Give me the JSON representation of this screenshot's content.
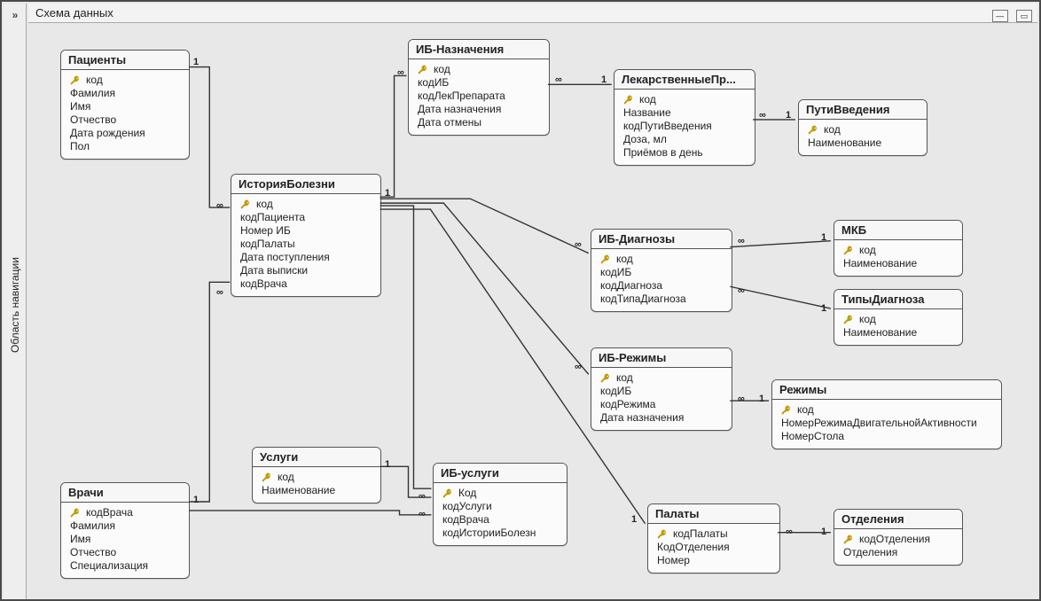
{
  "app": {
    "nav_toggle_glyph": "»",
    "nav_label": "Область навигации",
    "canvas_title": "Схема данных",
    "minimize_glyph": "—",
    "maximize_glyph": "▭"
  },
  "rel_labels": {
    "one": "1",
    "many": "∞"
  },
  "tables": {
    "patients": {
      "title": "Пациенты",
      "key": "код",
      "fields": [
        "Фамилия",
        "Имя",
        "Отчество",
        "Дата рождения",
        "Пол"
      ]
    },
    "doctors": {
      "title": "Врачи",
      "key": "кодВрача",
      "fields": [
        "Фамилия",
        "Имя",
        "Отчество",
        "Специализация"
      ]
    },
    "history": {
      "title": "ИсторияБолезни",
      "key": "код",
      "fields": [
        "кодПациента",
        "Номер ИБ",
        "кодПалаты",
        "Дата поступления",
        "Дата выписки",
        "кодВрача"
      ]
    },
    "services": {
      "title": "Услуги",
      "key": "код",
      "fields": [
        "Наименование"
      ]
    },
    "ib_naz": {
      "title": "ИБ-Назначения",
      "key": "код",
      "fields": [
        "кодИБ",
        "кодЛекПрепарата",
        "Дата назначения",
        "Дата отмены"
      ]
    },
    "ib_diag": {
      "title": "ИБ-Диагнозы",
      "key": "код",
      "fields": [
        "кодИБ",
        "кодДиагноза",
        "кодТипаДиагноза"
      ]
    },
    "ib_rezh": {
      "title": "ИБ-Режимы",
      "key": "код",
      "fields": [
        "кодИБ",
        "кодРежима",
        "Дата назначения"
      ]
    },
    "ib_serv": {
      "title": "ИБ-услуги",
      "key": "Код",
      "fields": [
        "кодУслуги",
        "кодВрача",
        "кодИсторииБолезн"
      ]
    },
    "drugs": {
      "title": "ЛекарственныеПр...",
      "key": "код",
      "fields": [
        "Название",
        "кодПутиВведения",
        "Доза, мл",
        "Приёмов в день"
      ]
    },
    "routes": {
      "title": "ПутиВведения",
      "key": "код",
      "fields": [
        "Наименование"
      ]
    },
    "mkb": {
      "title": "МКБ",
      "key": "код",
      "fields": [
        "Наименование"
      ]
    },
    "diagtypes": {
      "title": "ТипыДиагноза",
      "key": "код",
      "fields": [
        "Наименование"
      ]
    },
    "modes": {
      "title": "Режимы",
      "key": "код",
      "fields": [
        "НомерРежимаДвигательнойАктивности",
        "НомерСтола"
      ]
    },
    "wards": {
      "title": "Палаты",
      "key": "кодПалаты",
      "fields": [
        "КодОтделения",
        "Номер"
      ]
    },
    "depts": {
      "title": "Отделения",
      "key": "кодОтделения",
      "fields": [
        "Отделения"
      ]
    }
  }
}
